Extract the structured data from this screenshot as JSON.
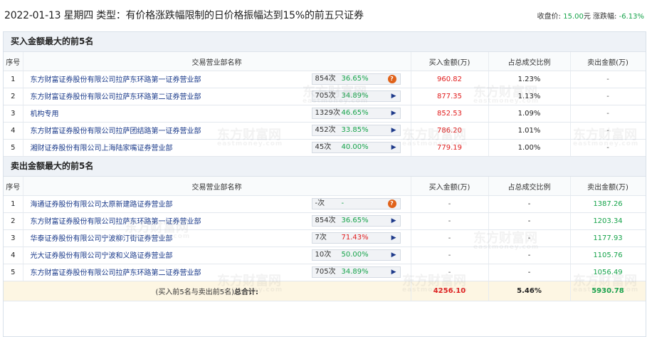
{
  "header": {
    "title": "2022-01-13 星期四 类型：有价格涨跌幅限制的日价格振幅达到15%的前五只证券",
    "close_label": "收盘价:",
    "close_value": "15.00",
    "close_unit": "元",
    "change_label": "涨跌幅:",
    "change_value": "-6.13%"
  },
  "buy_section": {
    "title": "买入金额最大的前5名",
    "columns": [
      "序号",
      "交易营业部名称",
      "买入金额(万)",
      "占总成交比例",
      "卖出金额(万)"
    ],
    "rows": [
      {
        "idx": "1",
        "name": "东方财富证券股份有限公司拉萨东环路第一证券营业部",
        "count": "854次",
        "pct": "36.65%",
        "icon": "question",
        "buy": "960.82",
        "ratio": "1.23%",
        "sell": "-"
      },
      {
        "idx": "2",
        "name": "东方财富证券股份有限公司拉萨东环路第二证券营业部",
        "count": "705次",
        "pct": "34.89%",
        "icon": "arrow",
        "buy": "877.35",
        "ratio": "1.13%",
        "sell": "-"
      },
      {
        "idx": "3",
        "name": "机构专用",
        "count": "1329次",
        "pct": "46.65%",
        "icon": "arrow",
        "buy": "852.53",
        "ratio": "1.09%",
        "sell": "-"
      },
      {
        "idx": "4",
        "name": "东方财富证券股份有限公司拉萨团结路第一证券营业部",
        "count": "452次",
        "pct": "33.85%",
        "icon": "arrow",
        "buy": "786.20",
        "ratio": "1.01%",
        "sell": "-"
      },
      {
        "idx": "5",
        "name": "湘财证券股份有限公司上海陆家嘴证券营业部",
        "count": "45次",
        "pct": "40.00%",
        "icon": "arrow",
        "buy": "779.19",
        "ratio": "1.00%",
        "sell": "-"
      }
    ]
  },
  "sell_section": {
    "title": "卖出金额最大的前5名",
    "columns": [
      "序号",
      "交易营业部名称",
      "买入金额(万)",
      "占总成交比例",
      "卖出金额(万)"
    ],
    "rows": [
      {
        "idx": "1",
        "name": "海通证券股份有限公司太原新建路证券营业部",
        "count": "-次",
        "pct": "-",
        "icon": "question",
        "buy": "-",
        "ratio": "-",
        "sell": "1387.26"
      },
      {
        "idx": "2",
        "name": "东方财富证券股份有限公司拉萨东环路第一证券营业部",
        "count": "854次",
        "pct": "36.65%",
        "icon": "arrow",
        "buy": "-",
        "ratio": "-",
        "sell": "1203.34"
      },
      {
        "idx": "3",
        "name": "华泰证券股份有限公司宁波柳汀街证券营业部",
        "count": "7次",
        "pct": "71.43%",
        "icon": "arrow",
        "buy": "-",
        "ratio": "-",
        "sell": "1177.93"
      },
      {
        "idx": "4",
        "name": "光大证券股份有限公司宁波和义路证券营业部",
        "count": "10次",
        "pct": "50.00%",
        "icon": "arrow",
        "buy": "-",
        "ratio": "-",
        "sell": "1105.76"
      },
      {
        "idx": "5",
        "name": "东方财富证券股份有限公司拉萨东环路第二证券营业部",
        "count": "705次",
        "pct": "34.89%",
        "icon": "arrow",
        "buy": "-",
        "ratio": "-",
        "sell": "1056.49"
      }
    ]
  },
  "total": {
    "label_prefix": "(买入前5名与卖出前5名)",
    "label_bold": "总合计:",
    "buy": "4256.10",
    "ratio": "5.46%",
    "sell": "5930.78"
  },
  "watermark": {
    "cn": "东方财富网",
    "en": "eastmoney.com"
  },
  "colors": {
    "up": "#e11d1d",
    "down": "#16a34a",
    "link": "#1a3a8a",
    "total_bg": "#fdf6e3"
  }
}
